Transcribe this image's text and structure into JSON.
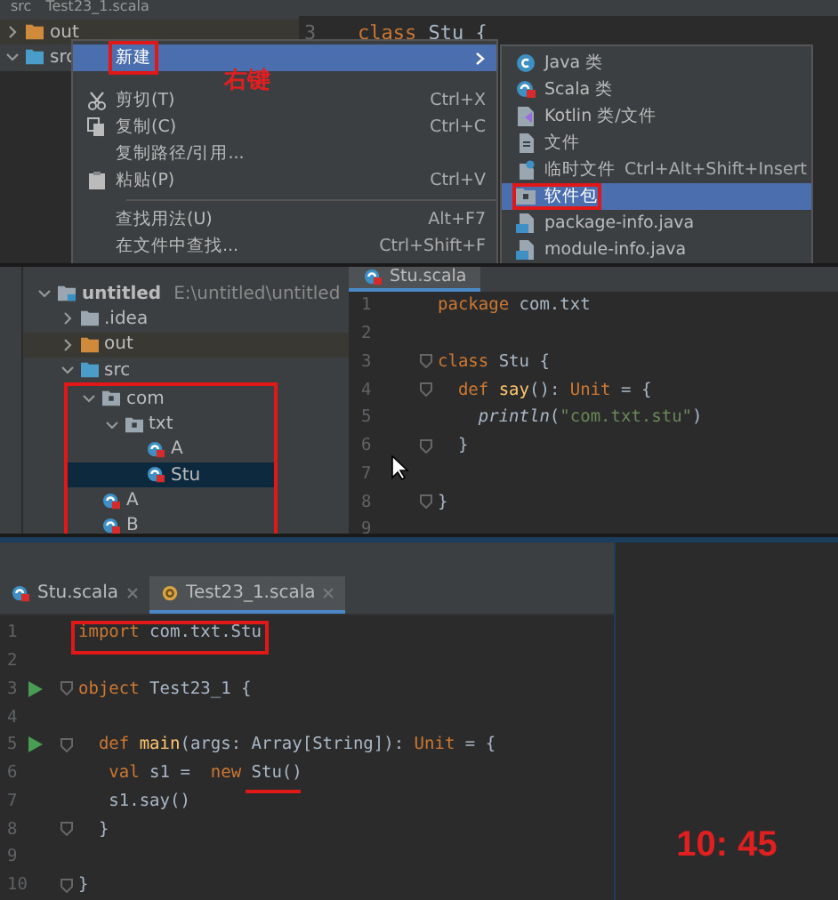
{
  "panel_1": {
    "breadcrumb": [
      "src",
      "Test23_1.scala"
    ],
    "tree": [
      {
        "label": "out",
        "kind": "excluded",
        "expanded": false,
        "selected": false
      },
      {
        "label": "src",
        "kind": "source",
        "expanded": true,
        "selected": false
      }
    ],
    "editor_line": {
      "number": "3",
      "tokens": [
        {
          "kind": "keyword",
          "t": "class "
        },
        {
          "kind": "plain",
          "t": "Stu {"
        }
      ]
    },
    "annotation": "右键",
    "context_menu": [
      {
        "kind": "plain",
        "label": "新建",
        "has_submenu": true,
        "selected": true,
        "boxed": true
      },
      {
        "kind": "separator"
      },
      {
        "kind": "cut",
        "label": "剪切(T)",
        "shortcut": "Ctrl+X",
        "selected": false,
        "boxed": false
      },
      {
        "kind": "copy",
        "label": "复制(C)",
        "shortcut": "Ctrl+C",
        "selected": false,
        "boxed": false
      },
      {
        "kind": "plain",
        "label": "复制路径/引用...",
        "selected": false,
        "boxed": false
      },
      {
        "kind": "paste",
        "label": "粘贴(P)",
        "shortcut": "Ctrl+V",
        "selected": false,
        "boxed": false
      },
      {
        "kind": "separator"
      },
      {
        "kind": "plain",
        "label": "查找用法(U)",
        "shortcut": "Alt+F7",
        "selected": false,
        "boxed": false
      },
      {
        "kind": "plain",
        "label": "在文件中查找...",
        "shortcut": "Ctrl+Shift+F",
        "selected": false,
        "boxed": false
      }
    ],
    "submenu": [
      {
        "kind": "java",
        "label": "Java 类",
        "selected": false,
        "boxed": false
      },
      {
        "kind": "scala",
        "label": "Scala 类",
        "selected": false,
        "boxed": false
      },
      {
        "kind": "kotlin",
        "label": "Kotlin 类/文件",
        "selected": false,
        "boxed": false
      },
      {
        "kind": "file",
        "label": "文件",
        "selected": false,
        "boxed": false
      },
      {
        "kind": "scratch",
        "label": "临时文件",
        "shortcut": "Ctrl+Alt+Shift+Insert",
        "selected": false,
        "boxed": false
      },
      {
        "kind": "package",
        "label": "软件包",
        "selected": true,
        "boxed": true
      },
      {
        "kind": "javafile",
        "label": "package-info.java",
        "selected": false,
        "boxed": false
      },
      {
        "kind": "javafile",
        "label": "module-info.java",
        "selected": false,
        "boxed": false
      }
    ]
  },
  "panel_2": {
    "tab": "Stu.scala",
    "tree": [
      {
        "label": "untitled",
        "detail": "E:\\untitled\\untitled",
        "kind": "module",
        "expanded": true,
        "selected": false,
        "children": [
          {
            "label": ".idea",
            "kind": "folder",
            "expanded": false,
            "selected": false
          },
          {
            "label": "out",
            "kind": "excluded",
            "expanded": false,
            "selected": false
          },
          {
            "label": "src",
            "kind": "source",
            "expanded": true,
            "selected": false,
            "children": [
              {
                "label": "com",
                "kind": "package",
                "expanded": true,
                "selected": false,
                "boxed": true,
                "children": [
                  {
                    "label": "txt",
                    "kind": "package",
                    "expanded": true,
                    "selected": false,
                    "boxed": true,
                    "children": [
                      {
                        "label": "A",
                        "kind": "scala",
                        "selected": false,
                        "boxed": true
                      },
                      {
                        "label": "Stu",
                        "kind": "scala",
                        "selected": true,
                        "boxed": true
                      }
                    ]
                  }
                ]
              },
              {
                "label": "A",
                "kind": "scala",
                "selected": false,
                "boxed": true
              },
              {
                "label": "B",
                "kind": "scala",
                "selected": false,
                "boxed": true
              }
            ]
          }
        ]
      }
    ],
    "code": [
      {
        "n": "1",
        "tokens": [
          {
            "kind": "keyword",
            "t": "package "
          },
          {
            "kind": "plain",
            "t": "com.txt"
          }
        ]
      },
      {
        "n": "2"
      },
      {
        "n": "3",
        "fold": true,
        "tokens": [
          {
            "kind": "keyword",
            "t": "class "
          },
          {
            "kind": "plain",
            "t": "Stu {"
          }
        ]
      },
      {
        "n": "4",
        "fold": true,
        "tokens": [
          {
            "kind": "keyword",
            "t": "  def "
          },
          {
            "kind": "function",
            "t": "say"
          },
          {
            "kind": "plain",
            "t": "(): "
          },
          {
            "kind": "keyword",
            "t": "Unit "
          },
          {
            "kind": "plain",
            "t": "= {"
          }
        ]
      },
      {
        "n": "5",
        "tokens": [
          {
            "kind": "italic",
            "t": "    println"
          },
          {
            "kind": "plain",
            "t": "("
          },
          {
            "kind": "string",
            "t": "\"com.txt.stu\""
          },
          {
            "kind": "plain",
            "t": ")"
          }
        ]
      },
      {
        "n": "6",
        "fold": true,
        "tokens": [
          {
            "kind": "plain",
            "t": "  }"
          }
        ]
      },
      {
        "n": "7"
      },
      {
        "n": "8",
        "fold": true,
        "tokens": [
          {
            "kind": "plain",
            "t": "}"
          }
        ]
      },
      {
        "n": "9"
      }
    ]
  },
  "panel_3": {
    "tabs": [
      {
        "label": "Stu.scala",
        "kind": "scala",
        "selected": false
      },
      {
        "label": "Test23_1.scala",
        "kind": "object",
        "selected": true
      }
    ],
    "code": [
      {
        "n": "1",
        "boxed": true,
        "tokens": [
          {
            "kind": "keyword",
            "t": "import "
          },
          {
            "kind": "plain",
            "t": "com.txt.Stu"
          }
        ]
      },
      {
        "n": "2"
      },
      {
        "n": "3",
        "run": true,
        "fold": true,
        "tokens": [
          {
            "kind": "keyword",
            "t": "object "
          },
          {
            "kind": "plain",
            "t": "Test23_1 {"
          }
        ]
      },
      {
        "n": "4"
      },
      {
        "n": "5",
        "run": true,
        "fold": true,
        "tokens": [
          {
            "kind": "keyword",
            "t": "  def "
          },
          {
            "kind": "function",
            "t": "main"
          },
          {
            "kind": "plain",
            "t": "(args: Array[String]): "
          },
          {
            "kind": "keyword",
            "t": "Unit "
          },
          {
            "kind": "plain",
            "t": "= {"
          }
        ]
      },
      {
        "n": "6",
        "tokens": [
          {
            "kind": "keyword",
            "t": "   val "
          },
          {
            "kind": "plain",
            "t": "s1 =  "
          },
          {
            "kind": "keyword",
            "t": "new "
          },
          {
            "kind": "plain",
            "t": "Stu()",
            "underlined": true
          }
        ]
      },
      {
        "n": "7",
        "tokens": [
          {
            "kind": "plain",
            "t": "   s1.say()"
          }
        ]
      },
      {
        "n": "8",
        "fold": true,
        "tokens": [
          {
            "kind": "plain",
            "t": "  }"
          }
        ]
      },
      {
        "n": "9"
      },
      {
        "n": "10",
        "fold": true,
        "tokens": [
          {
            "kind": "plain",
            "t": "}"
          }
        ]
      }
    ],
    "overlay_text": "10: 45"
  }
}
